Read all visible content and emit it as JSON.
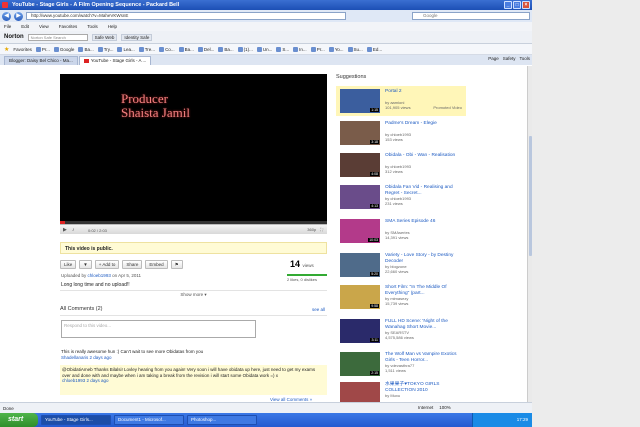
{
  "browser": {
    "window_title": "YouTube - Stage Girls - A Film Opening Sequence - Packard Bell",
    "url": "http://www.youtube.com/watch?v=MaheVKWsnE",
    "search_placeholder": "Google",
    "menu": [
      "File",
      "Edit",
      "View",
      "Favorites",
      "Tools",
      "Help"
    ],
    "norton": {
      "brand": "Norton",
      "search_placeholder": "Norton Safe Search",
      "items": [
        "Safe Web",
        "Identity Safe"
      ]
    },
    "favorites_label": "Favorites",
    "favorites": [
      "Pr...",
      "Google",
      "Ba...",
      "Try...",
      "Lea...",
      "Tre...",
      "Co...",
      "Ba...",
      "Del...",
      "Ba...",
      "(1)...",
      "Un...",
      "S...",
      "In...",
      "Pr...",
      "Yo...",
      "Su...",
      "Ed..."
    ],
    "tabs": [
      "Blogger: Daisy Bel Chico - Ma...",
      "YouTube - Stage Girls - A ..."
    ],
    "command_bar": [
      "Page",
      "Safety",
      "Tools"
    ]
  },
  "video": {
    "credit_line1": "Producer",
    "credit_line2": "Shaista Jamil",
    "time": "0:02 / 2:03",
    "quality": "360p",
    "public_notice": "This video is public.",
    "actions": {
      "like": "Like",
      "add_to": "+ Add to",
      "share": "Share",
      "embed": "Embed"
    },
    "views_count": "14",
    "views_label": "views",
    "uploaded_prefix": "Uploaded by",
    "uploader": "chloeb1993",
    "uploaded_date": "on Apr 5, 2011",
    "likes_text": "2 likes, 0 dislikes",
    "description": "Long long time and no upload!!",
    "show_more": "Show more"
  },
  "comments": {
    "header": "All Comments (2)",
    "see_all": "see all",
    "placeholder": "Respond to this video...",
    "items": [
      {
        "text": "This is really awesome hun :) Can't wait to see more Obidatas from you",
        "meta": "Shadellanaris 2 days ago"
      },
      {
        "text": "@ObidatiAmeb Thanks Bilalsi! Lovley hearing from you again! Very soon i will have obidata up here, just need to get my exams over and done with and maybe when i am taking a break from the revision i will start some Obidata work =) x",
        "meta": "chloeb1993 2 days ago"
      }
    ],
    "view_all": "View all Comments »"
  },
  "suggestions": {
    "header": "Suggestions",
    "items": [
      {
        "title": "Portal 2",
        "by": "by aamioni",
        "views": "101,905 views",
        "duration": "1:15",
        "tag": "Promoted Video",
        "color": "#3b5e9e"
      },
      {
        "title": "Padme's Dream - Elegie",
        "by": "by chloeb1993",
        "views": "153 views",
        "duration": "3:18",
        "color": "#7a5c4a"
      },
      {
        "title": "Obidala - Obi - Wan - Realisation",
        "by": "by chloeb1993",
        "views": "312 views",
        "duration": "4:08",
        "color": "#5a3d35"
      },
      {
        "title": "Obidala Fan Vid - Realising and Regret - Secret...",
        "by": "by chloeb1993",
        "views": "231 views",
        "duration": "4:13",
        "color": "#6a4c8a"
      },
      {
        "title": "SMA Series Episode 46",
        "by": "by SMAseries",
        "views": "14,391 views",
        "duration": "10:03",
        "color": "#b33a8a"
      },
      {
        "title": "Variety - Love Story - by Destiny Decoder",
        "by": "by blogzone",
        "views": "22,660 views",
        "duration": "5:20",
        "color": "#4f6b8a"
      },
      {
        "title": "Short Film: \"In The Middle Of Everything\" (part...",
        "by": "by mimasezy",
        "views": "15,739 views",
        "duration": "9:58",
        "color": "#caa64a"
      },
      {
        "title": "FULL HD Scene: 'Night of the Wanahag Short Movie...",
        "by": "by SEARSTV",
        "views": "4,575,586 views",
        "duration": "3:11",
        "color": "#2a2a6a"
      },
      {
        "title": "The Wolf Man vs Vampire Exotics Girls - Teen Horror...",
        "by": "by vdevasthra77",
        "views": "1,511 views",
        "duration": "2:15",
        "color": "#3c6a3c"
      },
      {
        "title": "水果果子♥TOKYO GIRLS COLLECTION 2010",
        "by": "by Muxu",
        "views": "",
        "duration": "",
        "color": "#a04848"
      }
    ]
  },
  "status": {
    "text": "Done",
    "zone": "Internet",
    "zoom": "100%"
  },
  "taskbar": {
    "start": "start",
    "tasks": [
      "YouTube - Stage Girls...",
      "Document1 - Microsof...",
      "Photoshop..."
    ],
    "clock": "17:29"
  }
}
